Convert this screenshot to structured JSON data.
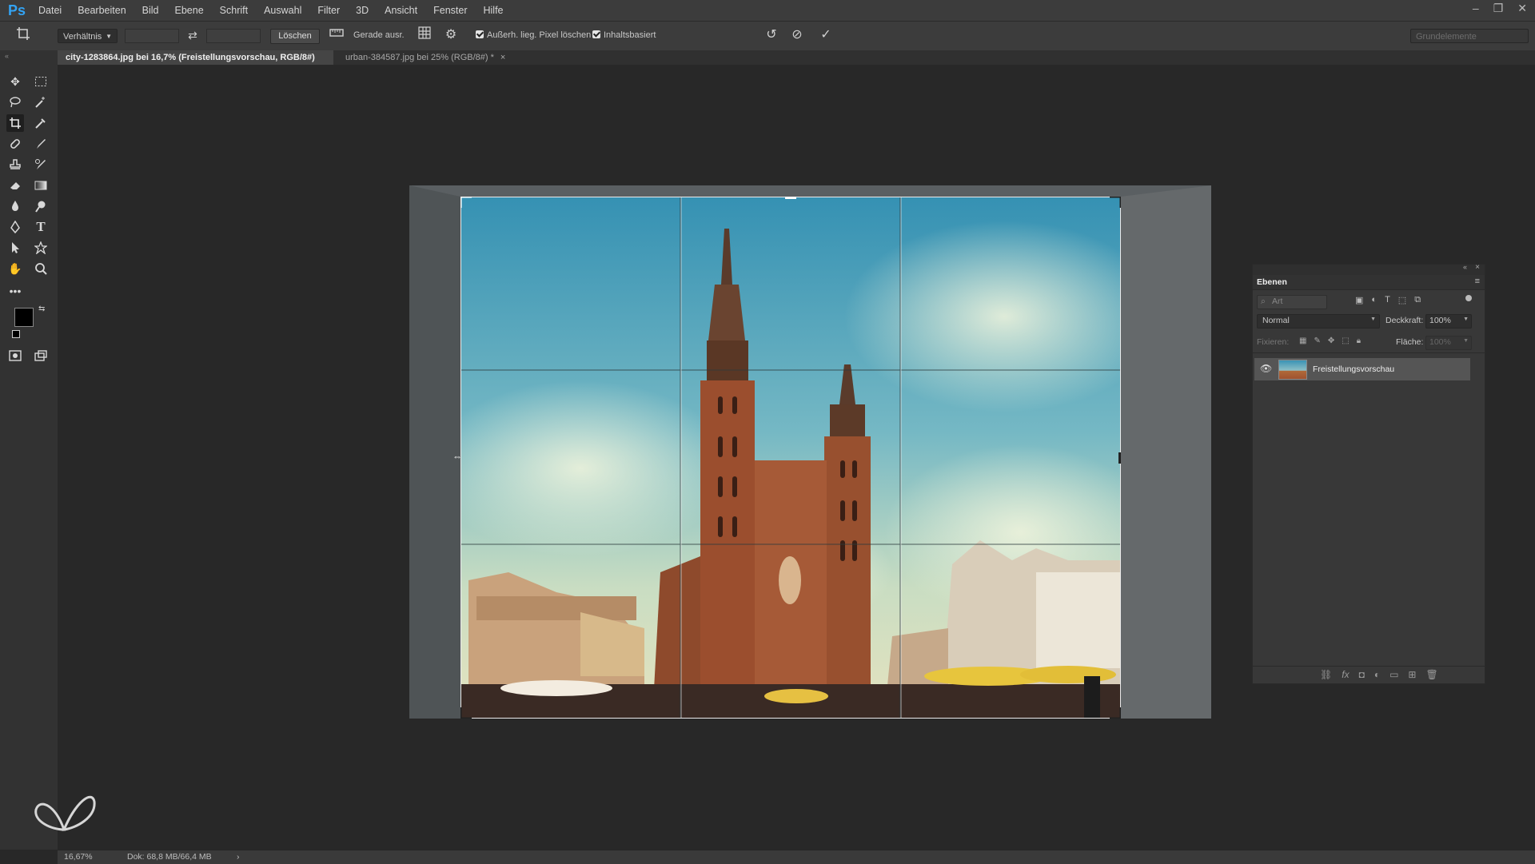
{
  "app": {
    "logo": "Ps"
  },
  "menu": [
    "Datei",
    "Bearbeiten",
    "Bild",
    "Ebene",
    "Schrift",
    "Auswahl",
    "Filter",
    "3D",
    "Ansicht",
    "Fenster",
    "Hilfe"
  ],
  "window_controls": {
    "minimize": "–",
    "restore": "❐",
    "close": "✕"
  },
  "options": {
    "ratio_select": "Verhältnis",
    "clear_button": "Löschen",
    "straighten_label": "Gerade ausr.",
    "delete_pixels_label": "Außerh. lieg. Pixel löschen",
    "content_aware_label": "Inhaltsbasiert",
    "workspace_select": "Grundelemente"
  },
  "tabs": [
    {
      "label": "city-1283864.jpg bei 16,7% (Freistellungsvorschau, RGB/8#) *",
      "active": true
    },
    {
      "label": "urban-384587.jpg bei 25% (RGB/8#) *",
      "active": false
    }
  ],
  "tools": [
    "move",
    "marquee",
    "lasso",
    "magic-wand",
    "crop",
    "eyedropper",
    "healing",
    "brush",
    "stamp",
    "history-brush",
    "eraser",
    "gradient",
    "blur",
    "dodge",
    "pen",
    "type",
    "path-select",
    "shape",
    "hand",
    "zoom",
    "more"
  ],
  "status": {
    "zoom": "16,67%",
    "doc": "Dok: 68,8 MB/66,4 MB",
    "arrow": "›"
  },
  "layers_panel": {
    "title": "Ebenen",
    "filter_placeholder": "Art",
    "blend_mode": "Normal",
    "opacity_label": "Deckkraft:",
    "opacity_value": "100%",
    "lock_label": "Fixieren:",
    "fill_label": "Fläche:",
    "fill_value": "100%",
    "layers": [
      {
        "name": "Freistellungsvorschau",
        "visible": true
      }
    ]
  },
  "colors": {
    "accent": "#33a3f3",
    "foreground": "#000000",
    "background": "#ffffff"
  }
}
